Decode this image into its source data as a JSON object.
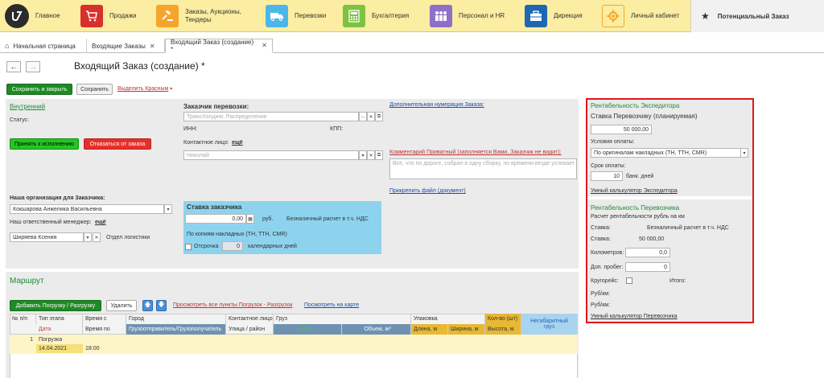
{
  "nav": {
    "items": [
      {
        "label": "Главное",
        "icon": "logo-icon",
        "color": "#2b2b2b"
      },
      {
        "label": "Продажи",
        "icon": "cart-icon",
        "color": "#d9302c"
      },
      {
        "label": "Заказы, Аукционы,\nТендеры",
        "icon": "gavel-icon",
        "color": "#f5a52a"
      },
      {
        "label": "Перевозки",
        "icon": "truck-icon",
        "color": "#4db6e8"
      },
      {
        "label": "Бухгалтерия",
        "icon": "calculator-icon",
        "color": "#7dc242"
      },
      {
        "label": "Персонал и HR",
        "icon": "people-icon",
        "color": "#8e6fc9"
      },
      {
        "label": "Дирекция",
        "icon": "briefcase-icon",
        "color": "#1f67b1"
      },
      {
        "label": "Личный кабинет",
        "icon": "gear-icon",
        "color": "#f5a52a"
      }
    ],
    "potential": "Потенциальный Заказ"
  },
  "tabs": [
    {
      "label": "Начальная страница"
    },
    {
      "label": "Входящие Заказы"
    },
    {
      "label": "Входящий Заказ (создание) *"
    }
  ],
  "page": {
    "title": "Входящий Заказ (создание) *",
    "save_close": "Сохранить и закрыть",
    "save": "Сохранить",
    "highlight": "Выделить Красным"
  },
  "internal": {
    "title": "Внутренний",
    "status_label": "Статус:",
    "accept": "Принять к исполнению",
    "refuse": "Отказаться от заказа"
  },
  "customer": {
    "title": "Заказчик перевозки:",
    "placeholder": "ТрансХолдинг, Распределение",
    "inn": "ИНН:",
    "kpp": "КПП:",
    "contact_label": "Контактное лицо:",
    "contact_link": "ещё",
    "contact_placeholder": "Николай"
  },
  "extra": {
    "numbering": "Дополнительная нумерация Заказа:",
    "comment_label": "Комментарий Приватный (заполняется Вами, Заказчик не видит):",
    "comment_placeholder": "Все, что по дороге, собрал в одну сборку, по времени везде успевает",
    "attach": "Прикрепить файл (документ)"
  },
  "org": {
    "title": "Наша организация для Заказчика:",
    "name": "Кокшарова Анжелика Васильевна",
    "manager_label": "Наш ответственный менеджер:",
    "manager_link": "ещё",
    "manager": "Ширяева Ксения",
    "dept": "Отдел логистики"
  },
  "rate": {
    "title": "Ставка заказчика",
    "value": "0,00",
    "currency": "руб.",
    "payment": "Безналичный расчет в т.ч. НДС",
    "basis": "По копиям накладных (ТН, ТТН, CMR)",
    "delay_label": "Отсрочка",
    "delay_value": "0",
    "delay_unit": "календарных дней"
  },
  "route": {
    "title": "Маршрут",
    "add": "Добавить Погрузку / Разгрузку",
    "delete": "Удалить",
    "view_all": "Просмотреть все пункты Погрузок - Разгрузок",
    "map": "Посмотреть на карте",
    "headers": {
      "num": "№ п/п",
      "stage_type": "Тип этапа",
      "date": "Дата",
      "time_from": "Время с",
      "time_to": "Время по",
      "city": "Город",
      "shipper": "Грузоотправитель/Грузополучатель",
      "contact": "Контактное лицо",
      "street": "Улица / район",
      "cargo": "Груз",
      "weight": "Вес, т",
      "volume": "Объем, м³",
      "packaging": "Упаковка",
      "length": "Длина, м",
      "width": "Ширина, м",
      "qty": "Кол-во (шт)",
      "height": "Высота, м",
      "oversize": "Негабаритный груз"
    },
    "rows": [
      {
        "num": "1",
        "stage": "Погрузка",
        "date": "14.04.2021",
        "time_from": "",
        "time_to": "18:00"
      }
    ]
  },
  "expeditor": {
    "title": "Рентабельность Экспедитора",
    "subtitle": "Ставка Перевозчику (планируемая)",
    "rate_value": "50 000,00",
    "pay_label": "Условия оплаты:",
    "pay_value": "По оригиналам накладных (ТН, ТТН, CMR)",
    "term_label": "Срок оплаты:",
    "term_value": "10",
    "term_unit": "банк. дней",
    "calc_link": "Умный калькулятор Экспедитора"
  },
  "carrier": {
    "title": "Рентабельность Перевозчика",
    "subtitle": "Расчет рентабельности рубль на км",
    "rate_label": "Ставка:",
    "rate_type": "Безналичный расчет в т.ч. НДС",
    "rate2_label": "Ставка:",
    "rate2_value": "50 000,00",
    "km_label": "Километров:",
    "km_value": "0,0",
    "extra_label": "Доп. пробег:",
    "extra_value": "0",
    "round_label": "Кругорейс:",
    "total_label": "Итого:",
    "rubkm1": "Руб/км:",
    "rubkm2": "Руб/км:",
    "calc_link": "Умный калькулятор Перевозчика"
  }
}
